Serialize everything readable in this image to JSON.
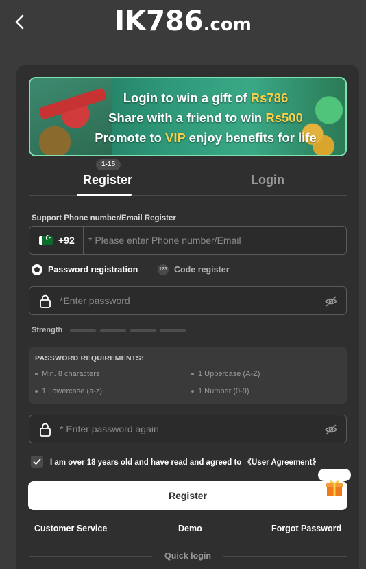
{
  "header": {
    "logo_main": "IK786",
    "logo_suffix": ".com"
  },
  "banner": {
    "line1_prefix": "Login to win a gift of ",
    "line1_highlight": "Rs786",
    "line2_prefix": "Share with a friend to win ",
    "line2_highlight": "Rs500",
    "line3_prefix": "Promote to ",
    "line3_highlight": "VIP",
    "line3_suffix": " enjoy benefits for life"
  },
  "tabs": {
    "badge": "1-15",
    "register": "Register",
    "login": "Login"
  },
  "form": {
    "support_label": "Support Phone number/Email Register",
    "country_code": "+92",
    "phone_placeholder": "* Please enter Phone number/Email",
    "mode_password": "Password registration",
    "mode_code": "Code register",
    "mode_code_icon_text": "123",
    "password_placeholder": "*Enter password",
    "strength_label": "Strength",
    "confirm_placeholder": "* Enter password again"
  },
  "requirements": {
    "title": "PASSWORD REQUIREMENTS:",
    "items": [
      "Min. 8 characters",
      "1 Uppercase (A-Z)",
      "1 Lowercase (a-z)",
      "1 Number (0-9)"
    ]
  },
  "agreement": {
    "text": "I am over 18 years old and have read and agreed to",
    "link": "《User Agreement》"
  },
  "register_button": "Register",
  "footer": {
    "customer_service": "Customer Service",
    "demo": "Demo",
    "forgot_password": "Forgot Password",
    "quick_login": "Quick login"
  },
  "colors": {
    "background": "#3b3b3b",
    "card": "#2f2f2f",
    "accent_highlight": "#f5d04a",
    "gift_orange": "#f07a1a"
  }
}
